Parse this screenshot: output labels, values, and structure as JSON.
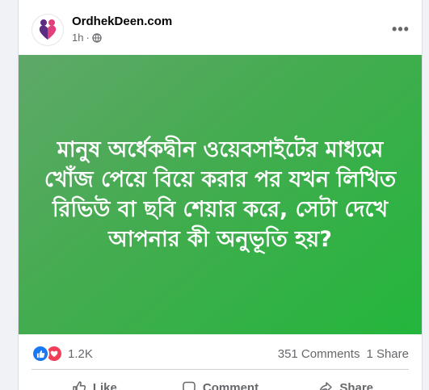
{
  "post": {
    "page_name": "OrdhekDeen.com",
    "time": "1h",
    "image_text": "মানুষ অর্ধেকদ্বীন ওয়েবসাইটের মাধ্যমে খোঁজ পেয়ে বিয়ে করার পর যখন লিখিত রিভিউ বা ছবি শেয়ার করে, সেটা দেখে আপনার কী অনুভূতি হয়?",
    "reactions_count": "1.2K",
    "comments_count": "351 Comments",
    "shares_count": "1 Share"
  },
  "actions": {
    "like": "Like",
    "comment": "Comment",
    "share": "Share"
  },
  "icons": {
    "more": "more-horizontal-icon",
    "audience": "globe-icon",
    "like": "thumbs-up-icon",
    "comment": "comment-bubble-icon",
    "share": "share-arrow-icon"
  },
  "colors": {
    "post_background": "#43ac4f",
    "like_blue": "#1877f2",
    "love_red": "#f33e58",
    "logo_purple": "#5c2c83",
    "logo_pink": "#e0407b"
  }
}
